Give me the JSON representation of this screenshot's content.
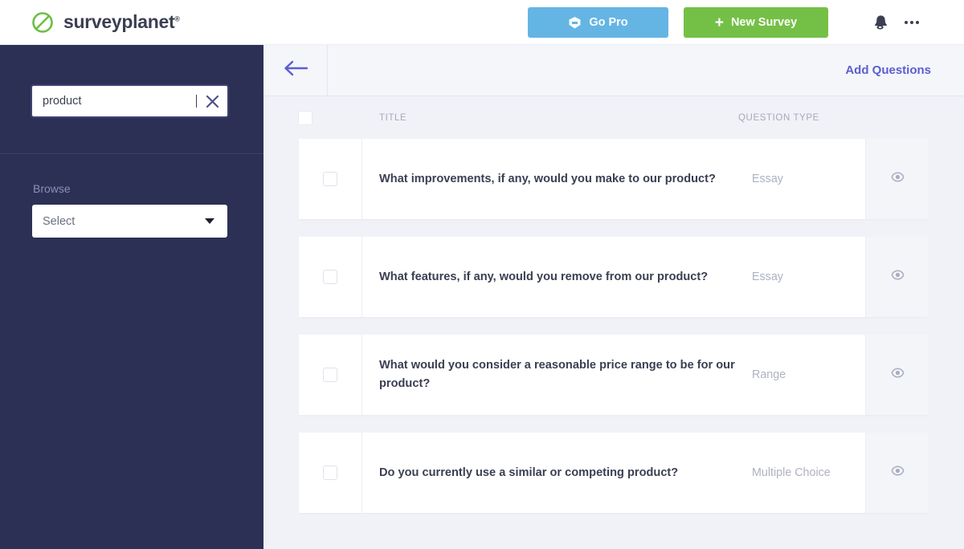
{
  "header": {
    "brand_name": "surveyplanet",
    "brand_tm": "®",
    "logo_icon": "surveyplanet-logo-icon",
    "go_pro_label": "Go Pro",
    "go_pro_icon": "badge-icon",
    "go_pro_color": "#64b5e4",
    "new_survey_label": "New Survey",
    "new_survey_icon": "plus-icon",
    "new_survey_color": "#74c046",
    "plus_glyph": "+",
    "bell_icon": "bell-icon",
    "more_icon": "ellipsis-icon"
  },
  "sidebar": {
    "background_color": "#2d3055",
    "search": {
      "value": "product",
      "placeholder": "Search",
      "clear_icon": "close-icon"
    },
    "browse": {
      "label": "Browse",
      "select_value": "Select",
      "select_placeholder": "Select",
      "chevron_icon": "chevron-down-icon"
    }
  },
  "main": {
    "back_icon": "arrow-left-icon",
    "add_questions_label": "Add Questions",
    "accent_color": "#5b5fcf",
    "table": {
      "columns": [
        "TITLE",
        "QUESTION TYPE"
      ],
      "select_all_checked": false,
      "rows": [
        {
          "title": "What improvements, if any, would you make to our product?",
          "type": "Essay",
          "checked": false,
          "preview_icon": "eye-icon"
        },
        {
          "title": "What features, if any, would you remove from our product?",
          "type": "Essay",
          "checked": false,
          "preview_icon": "eye-icon"
        },
        {
          "title": "What would you consider a reasonable price range to be for our product?",
          "type": "Range",
          "checked": false,
          "preview_icon": "eye-icon"
        },
        {
          "title": "Do you currently use a similar or competing product?",
          "type": "Multiple Choice",
          "checked": false,
          "preview_icon": "eye-icon"
        }
      ]
    }
  }
}
